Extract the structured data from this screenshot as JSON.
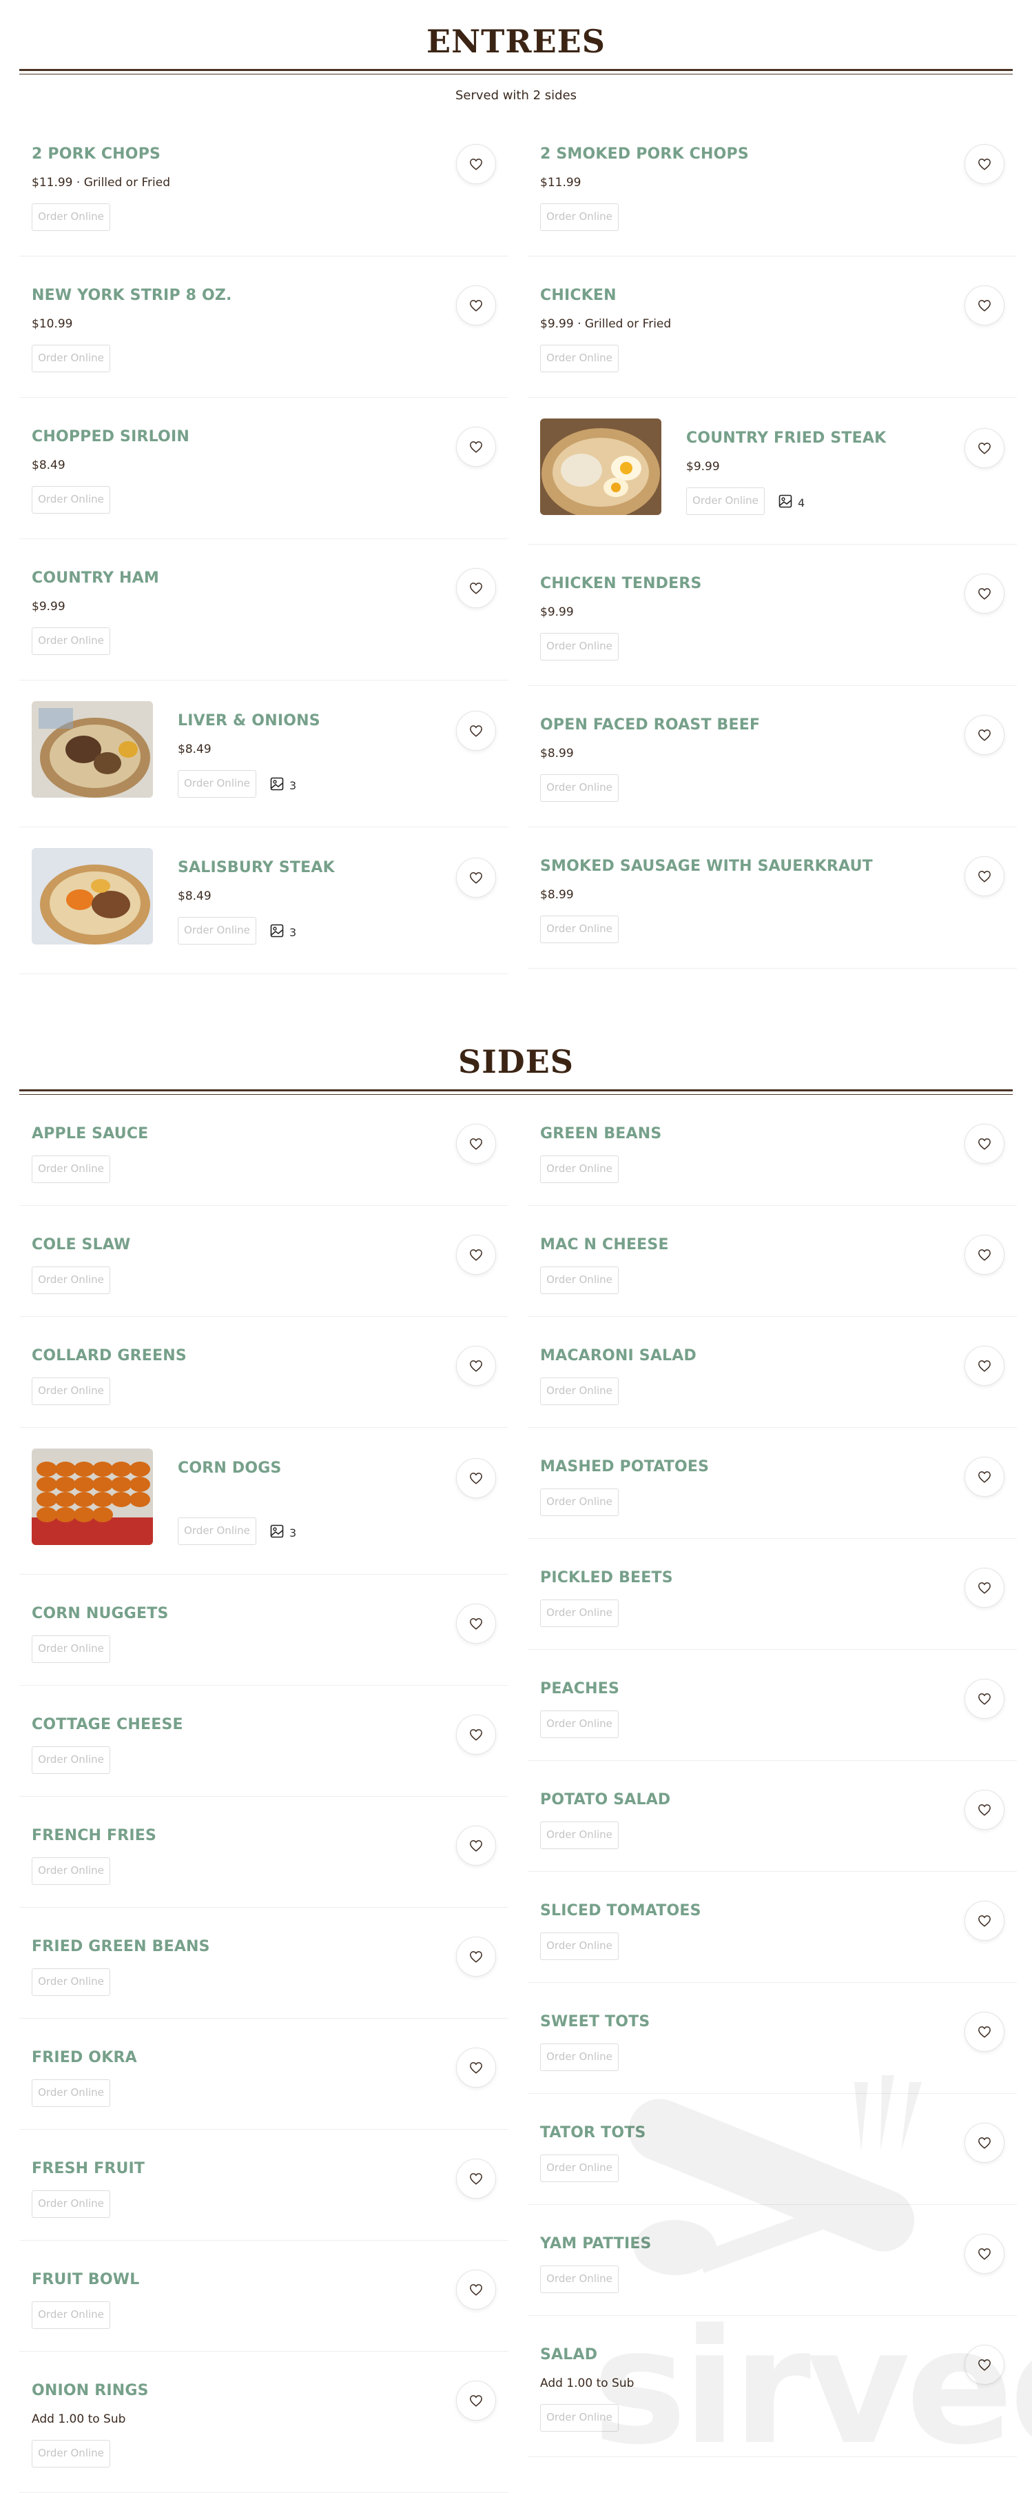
{
  "entrees": {
    "title": "ENTREES",
    "subtitle": "Served with 2 sides",
    "order_label": "Order Online",
    "left": [
      {
        "name": "2 PORK CHOPS",
        "price": "$11.99 · Grilled or Fried"
      },
      {
        "name": "NEW YORK STRIP 8 OZ.",
        "price": "$10.99"
      },
      {
        "name": "CHOPPED SIRLOIN",
        "price": "$8.49"
      },
      {
        "name": "COUNTRY HAM",
        "price": "$9.99"
      },
      {
        "name": "LIVER & ONIONS",
        "price": "$8.49",
        "photos": "3"
      },
      {
        "name": "SALISBURY STEAK",
        "price": "$8.49",
        "photos": "3"
      }
    ],
    "right": [
      {
        "name": "2 SMOKED PORK CHOPS",
        "price": "$11.99"
      },
      {
        "name": "CHICKEN",
        "price": "$9.99 · Grilled or Fried"
      },
      {
        "name": "COUNTRY FRIED STEAK",
        "price": "$9.99",
        "photos": "4"
      },
      {
        "name": "CHICKEN TENDERS",
        "price": "$9.99"
      },
      {
        "name": "OPEN FACED ROAST BEEF",
        "price": "$8.99"
      },
      {
        "name": "SMOKED SAUSAGE WITH SAUERKRAUT",
        "price": "$8.99"
      }
    ]
  },
  "sides": {
    "title": "SIDES",
    "order_label": "Order Online",
    "left": [
      {
        "name": "APPLE SAUCE"
      },
      {
        "name": "COLE SLAW"
      },
      {
        "name": "COLLARD GREENS"
      },
      {
        "name": "CORN DOGS",
        "photos": "3"
      },
      {
        "name": "CORN NUGGETS"
      },
      {
        "name": "COTTAGE CHEESE"
      },
      {
        "name": "FRENCH FRIES"
      },
      {
        "name": "FRIED GREEN BEANS"
      },
      {
        "name": "FRIED OKRA"
      },
      {
        "name": "FRESH FRUIT"
      },
      {
        "name": "FRUIT BOWL"
      },
      {
        "name": "ONION RINGS",
        "price": "Add 1.00 to Sub"
      }
    ],
    "right": [
      {
        "name": "GREEN BEANS"
      },
      {
        "name": "MAC N CHEESE"
      },
      {
        "name": "MACARONI SALAD"
      },
      {
        "name": "MASHED POTATOES"
      },
      {
        "name": "PICKLED BEETS"
      },
      {
        "name": "PEACHES"
      },
      {
        "name": "POTATO SALAD"
      },
      {
        "name": "SLICED TOMATOES"
      },
      {
        "name": "SWEET TOTS"
      },
      {
        "name": "TATOR TOTS"
      },
      {
        "name": "YAM PATTIES"
      },
      {
        "name": "SALAD",
        "price": "Add 1.00 to Sub"
      }
    ]
  },
  "watermark": "sirved",
  "colors": {
    "item_name": "#76a08a",
    "heading": "#3b2414",
    "rule": "#4b3324"
  }
}
